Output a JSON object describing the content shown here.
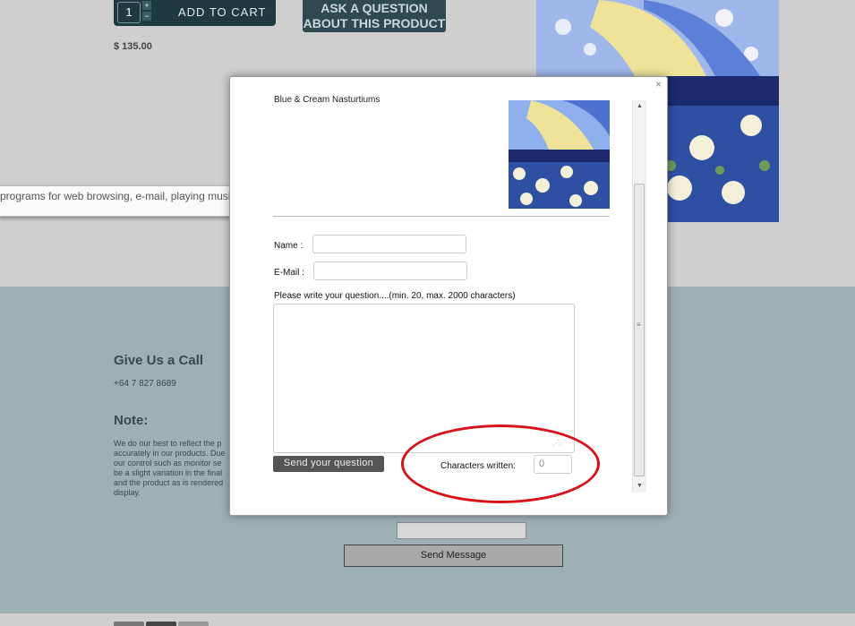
{
  "product": {
    "quantity": "1",
    "qty_plus": "+",
    "qty_minus": "−",
    "add_to_cart": "ADD TO CART",
    "ask_question_line1": "ASK A QUESTION",
    "ask_question_line2": "ABOUT THIS PRODUCT",
    "price": "$ 135.00"
  },
  "tooltip": {
    "text": "programs for web browsing, e-mail, playing music, and"
  },
  "footer": {
    "call_heading": "Give Us a Call",
    "phone": "+64 7 827 8689",
    "note_heading": "Note:",
    "note_text": "We do our best to reflect the p accurately in our products. Due our control such as monitor se be a slight variation in the final and the product as is rendered display.",
    "send_message": "Send Message"
  },
  "modal": {
    "close_symbol": "×",
    "product_name": "Blue & Cream Nasturtiums",
    "name_label": "Name :",
    "email_label": "E-Mail :",
    "question_label": "Please write your question....(min. 20, max. 2000 characters)",
    "name_value": "",
    "email_value": "",
    "question_value": "",
    "send_question": "Send your question",
    "chars_label": "Characters written:",
    "chars_count": "0"
  },
  "colors": {
    "page_bg": "#cfcfcf",
    "footer_bg": "#9eb0b3",
    "cart_button": "#1e3a40",
    "annotation_red": "#d8121a"
  }
}
